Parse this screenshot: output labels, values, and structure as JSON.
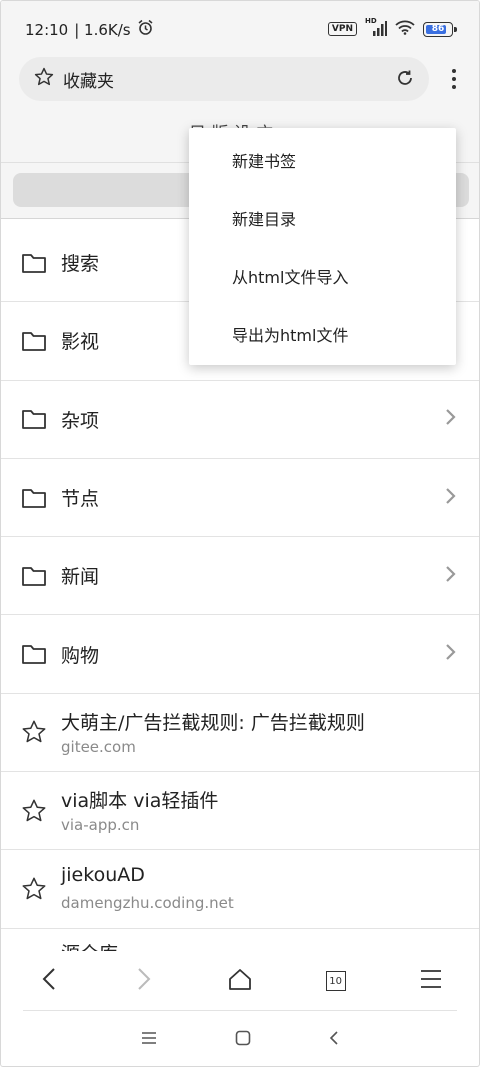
{
  "status_bar": {
    "time": "12:10",
    "speed": "| 1.6K/s",
    "vpn": "VPN",
    "hd": "HD",
    "battery": "86"
  },
  "address_bar": {
    "title": "收藏夹"
  },
  "header_partial": "目 版 设 方",
  "menu": {
    "items": [
      {
        "label": "新建书签"
      },
      {
        "label": "新建目录"
      },
      {
        "label": "从html文件导入"
      },
      {
        "label": "导出为html文件"
      }
    ]
  },
  "folders": [
    {
      "label": "搜索"
    },
    {
      "label": "影视"
    },
    {
      "label": "杂项"
    },
    {
      "label": "节点"
    },
    {
      "label": "新闻"
    },
    {
      "label": "购物"
    }
  ],
  "bookmarks": [
    {
      "title": "大萌主/广告拦截规则: 广告拦截规则",
      "url": "gitee.com"
    },
    {
      "title": "via脚本 via轻插件",
      "url": "via-app.cn"
    },
    {
      "title": "jiekouAD",
      "url": "damengzhu.coding.net"
    }
  ],
  "partial_bookmark": "源仓库",
  "bottom_nav": {
    "tab_count": "10"
  }
}
